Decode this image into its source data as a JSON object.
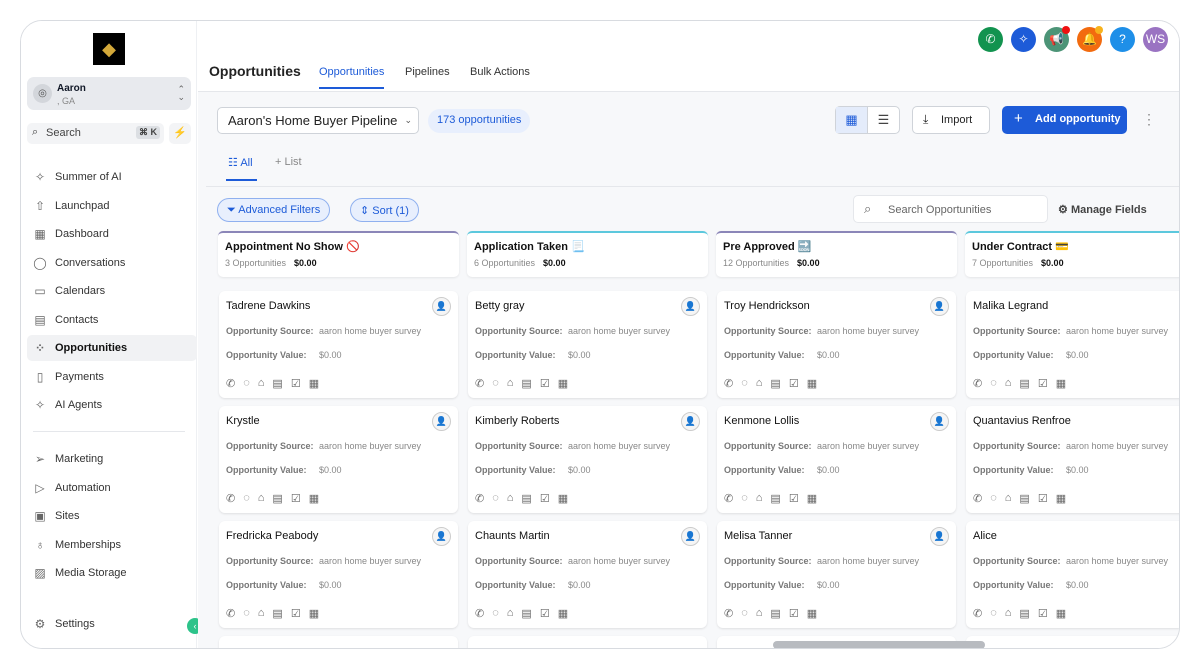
{
  "sidebar": {
    "account": {
      "name": "Aaron",
      "location": ", GA"
    },
    "search": {
      "placeholder": "Search",
      "shortcut": "⌘ K"
    },
    "items": [
      {
        "label": "Summer of AI",
        "icon": "sparkle-icon"
      },
      {
        "label": "Launchpad",
        "icon": "rocket-icon"
      },
      {
        "label": "Dashboard",
        "icon": "grid-icon"
      },
      {
        "label": "Conversations",
        "icon": "chat-icon"
      },
      {
        "label": "Calendars",
        "icon": "calendar-icon"
      },
      {
        "label": "Contacts",
        "icon": "contacts-icon"
      },
      {
        "label": "Opportunities",
        "icon": "opportunities-icon"
      },
      {
        "label": "Payments",
        "icon": "payments-icon"
      },
      {
        "label": "AI Agents",
        "icon": "sparkle-icon"
      }
    ],
    "items2": [
      {
        "label": "Marketing"
      },
      {
        "label": "Automation"
      },
      {
        "label": "Sites"
      },
      {
        "label": "Memberships"
      },
      {
        "label": "Media Storage"
      }
    ],
    "settings": "Settings"
  },
  "header": {
    "title": "Opportunities",
    "tabs": [
      "Opportunities",
      "Pipelines",
      "Bulk Actions"
    ],
    "avatar": "WS"
  },
  "toolbar": {
    "pipeline": "Aaron's Home Buyer Pipeline",
    "count": "173 opportunities",
    "import": "Import",
    "add": "Add opportunity"
  },
  "subtabs": {
    "all": "All",
    "list": "List"
  },
  "filters": {
    "advanced": "Advanced Filters",
    "sort": "Sort (1)",
    "search_placeholder": "Search Opportunities",
    "manage": "Manage Fields"
  },
  "labels": {
    "source": "Opportunity Source:",
    "value": "Opportunity Value:"
  },
  "colors": {
    "accent": "#1d5bd8"
  },
  "columns": [
    {
      "title": "Appointment No Show 🚫",
      "count": "3 Opportunities",
      "total": "$0.00",
      "color": "#8b86b8",
      "cards": [
        {
          "name": "Tadrene Dawkins",
          "source": "aaron home buyer survey",
          "value": "$0.00"
        },
        {
          "name": "Krystle",
          "source": "aaron home buyer survey",
          "value": "$0.00"
        },
        {
          "name": "Fredricka Peabody",
          "source": "aaron home buyer survey",
          "value": "$0.00"
        }
      ]
    },
    {
      "title": "Application Taken 📃",
      "count": "6 Opportunities",
      "total": "$0.00",
      "color": "#5cc8dd",
      "cards": [
        {
          "name": "Betty gray",
          "source": "aaron home buyer survey",
          "value": "$0.00"
        },
        {
          "name": "Kimberly Roberts",
          "source": "aaron home buyer survey",
          "value": "$0.00"
        },
        {
          "name": "Chaunts Martin",
          "source": "aaron home buyer survey",
          "value": "$0.00"
        }
      ]
    },
    {
      "title": "Pre Approved 🔜",
      "count": "12 Opportunities",
      "total": "$0.00",
      "color": "#8b86b8",
      "cards": [
        {
          "name": "Troy Hendrickson",
          "source": "aaron home buyer survey",
          "value": "$0.00"
        },
        {
          "name": "Kenmone Lollis",
          "source": "aaron home buyer survey",
          "value": "$0.00"
        },
        {
          "name": "Melisa Tanner",
          "source": "aaron home buyer survey",
          "value": "$0.00"
        }
      ]
    },
    {
      "title": "Under Contract 💳",
      "count": "7 Opportunities",
      "total": "$0.00",
      "color": "#5cc8dd",
      "cards": [
        {
          "name": "Malika Legrand",
          "source": "aaron home buyer survey",
          "value": "$0.00"
        },
        {
          "name": "Quantavius Renfroe",
          "source": "aaron home buyer survey",
          "value": "$0.00"
        },
        {
          "name": "Alice",
          "source": "aaron home buyer survey",
          "value": "$0.00"
        }
      ]
    }
  ]
}
